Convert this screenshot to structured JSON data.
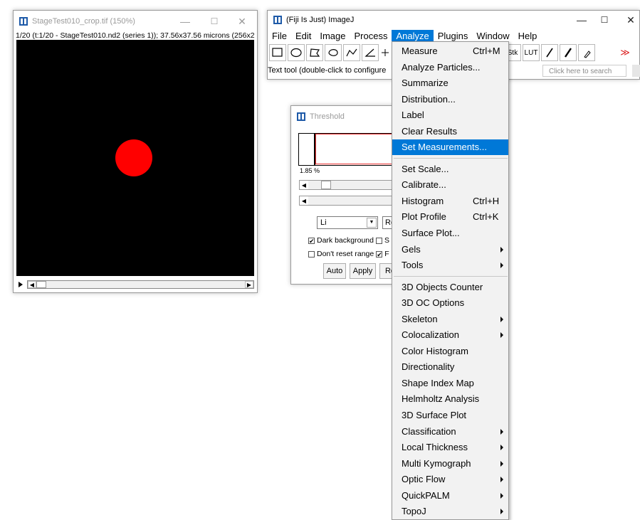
{
  "image_window": {
    "title": "StageTest010_crop.tif (150%)",
    "subtitle": "1/20 (t:1/20 - StageTest010.nd2 (series 1)); 37.56x37.56 microns (256x2",
    "minimize": "—",
    "maximize": "☐",
    "close": "✕"
  },
  "imagej_window": {
    "title": "(Fiji Is Just) ImageJ",
    "minimize": "—",
    "maximize": "☐",
    "close": "✕",
    "menubar": [
      "File",
      "Edit",
      "Image",
      "Process",
      "Analyze",
      "Plugins",
      "Window",
      "Help"
    ],
    "active_menu": "Analyze",
    "toolbar_tools": [
      "rectangle-tool-icon",
      "oval-tool-icon",
      "polygon-tool-icon",
      "freehand-tool-icon",
      "line-tool-icon",
      "angle-tool-icon",
      "point-tool-icon"
    ],
    "toolbar_right": [
      "Stk",
      "LUT"
    ],
    "more_tools": "≫",
    "status": "Text tool (double-click to configure",
    "search_placeholder": "Click here to search"
  },
  "threshold": {
    "title": "Threshold",
    "percent": "1.85 %",
    "method": "Li",
    "mode_partial": "Re",
    "dark_background": "Dark background",
    "dark_checked": "✔",
    "stack_partial": "S",
    "dont_reset_range": "Don't reset range",
    "raw_partial": "F",
    "raw_checked": "✔",
    "auto": "Auto",
    "apply": "Apply",
    "reset_partial": "Re"
  },
  "analyze_menu": {
    "items": [
      {
        "label": "Measure",
        "shortcut": "Ctrl+M"
      },
      {
        "label": "Analyze Particles..."
      },
      {
        "label": "Summarize"
      },
      {
        "label": "Distribution..."
      },
      {
        "label": "Label"
      },
      {
        "label": "Clear Results"
      },
      {
        "label": "Set Measurements..."
      },
      {
        "label": "Set Scale..."
      },
      {
        "label": "Calibrate..."
      },
      {
        "label": "Histogram",
        "shortcut": "Ctrl+H"
      },
      {
        "label": "Plot Profile",
        "shortcut": "Ctrl+K"
      },
      {
        "label": "Surface Plot..."
      },
      {
        "label": "Gels"
      },
      {
        "label": "Tools"
      },
      {
        "label": "3D Objects Counter"
      },
      {
        "label": "3D OC Options"
      },
      {
        "label": "Skeleton"
      },
      {
        "label": "Colocalization"
      },
      {
        "label": "Color Histogram"
      },
      {
        "label": "Directionality"
      },
      {
        "label": "Shape Index Map"
      },
      {
        "label": "Helmholtz Analysis"
      },
      {
        "label": "3D Surface Plot"
      },
      {
        "label": "Classification"
      },
      {
        "label": "Local Thickness"
      },
      {
        "label": "Multi Kymograph"
      },
      {
        "label": "Optic Flow"
      },
      {
        "label": "QuickPALM"
      },
      {
        "label": "TopoJ"
      }
    ],
    "highlighted": "Set Measurements..."
  },
  "colors": {
    "highlight": "#0078d7",
    "spot": "#ff0000",
    "canvas": "#000000"
  }
}
